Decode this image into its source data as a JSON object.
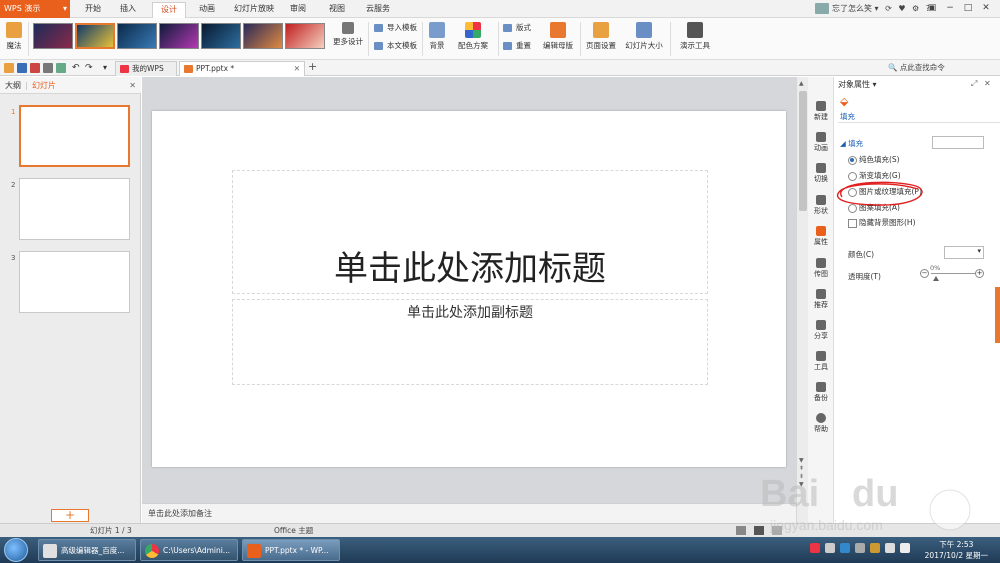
{
  "app": {
    "menu_label": "WPS 演示",
    "ribbon_tabs": [
      "开始",
      "插入",
      "设计",
      "动画",
      "幻灯片放映",
      "审阅",
      "视图",
      "云服务"
    ],
    "active_tab": "设计",
    "user_name": "忘了怎么笑",
    "help_label": "?"
  },
  "ribbon": {
    "magic_label": "魔法",
    "more_design_label": "更多设计",
    "import_template_label": "导入模板",
    "this_template_label": "本文模板",
    "background_label": "背景",
    "color_scheme_label": "配色方案",
    "layout_label": "版式",
    "reset_label": "重置",
    "edit_master_label": "编辑母版",
    "page_setup_label": "页面设置",
    "slide_size_label": "幻灯片大小",
    "presentation_tools_label": "演示工具"
  },
  "quick_access": {
    "doc_tabs": [
      {
        "label": "我的WPS",
        "active": false
      },
      {
        "label": "PPT.pptx *",
        "active": true
      }
    ],
    "search_label": "点此查找命令"
  },
  "left_pane": {
    "tab_outline": "大纲",
    "tab_slides": "幻灯片",
    "slide_numbers": [
      "1",
      "2",
      "3"
    ],
    "add_label": "+"
  },
  "slide": {
    "title_placeholder": "单击此处添加标题",
    "subtitle_placeholder": "单击此处添加副标题"
  },
  "notes_placeholder": "单击此处添加备注",
  "sidebar": {
    "items": [
      "新建",
      "动画",
      "切换",
      "形状",
      "属性",
      "传图",
      "推荐",
      "分享",
      "工具",
      "备份",
      "帮助"
    ]
  },
  "props": {
    "title": "对象属性",
    "fill_tab": "填充",
    "fill_section": "填充",
    "options": [
      "纯色填充(S)",
      "渐变填充(G)",
      "图片或纹理填充(P)",
      "图案填充(A)"
    ],
    "hide_bg_graphics": "隐藏背景图形(H)",
    "color_label": "颜色(C)",
    "transparency_label": "透明度(T)",
    "transparency_value": "0%"
  },
  "status": {
    "slide_counter": "幻灯片 1 / 3",
    "theme": "Office 主题"
  },
  "taskbar": {
    "tasks": [
      "高级编辑器_百度...",
      "C:\\Users\\Admini...",
      "PPT.pptx * - WP..."
    ],
    "time": "下午 2:53",
    "date": "2017/10/2 星期一"
  },
  "colors": {
    "accent": "#e8601c",
    "selection": "#e8782f",
    "taskbar": "#2a4a68"
  }
}
